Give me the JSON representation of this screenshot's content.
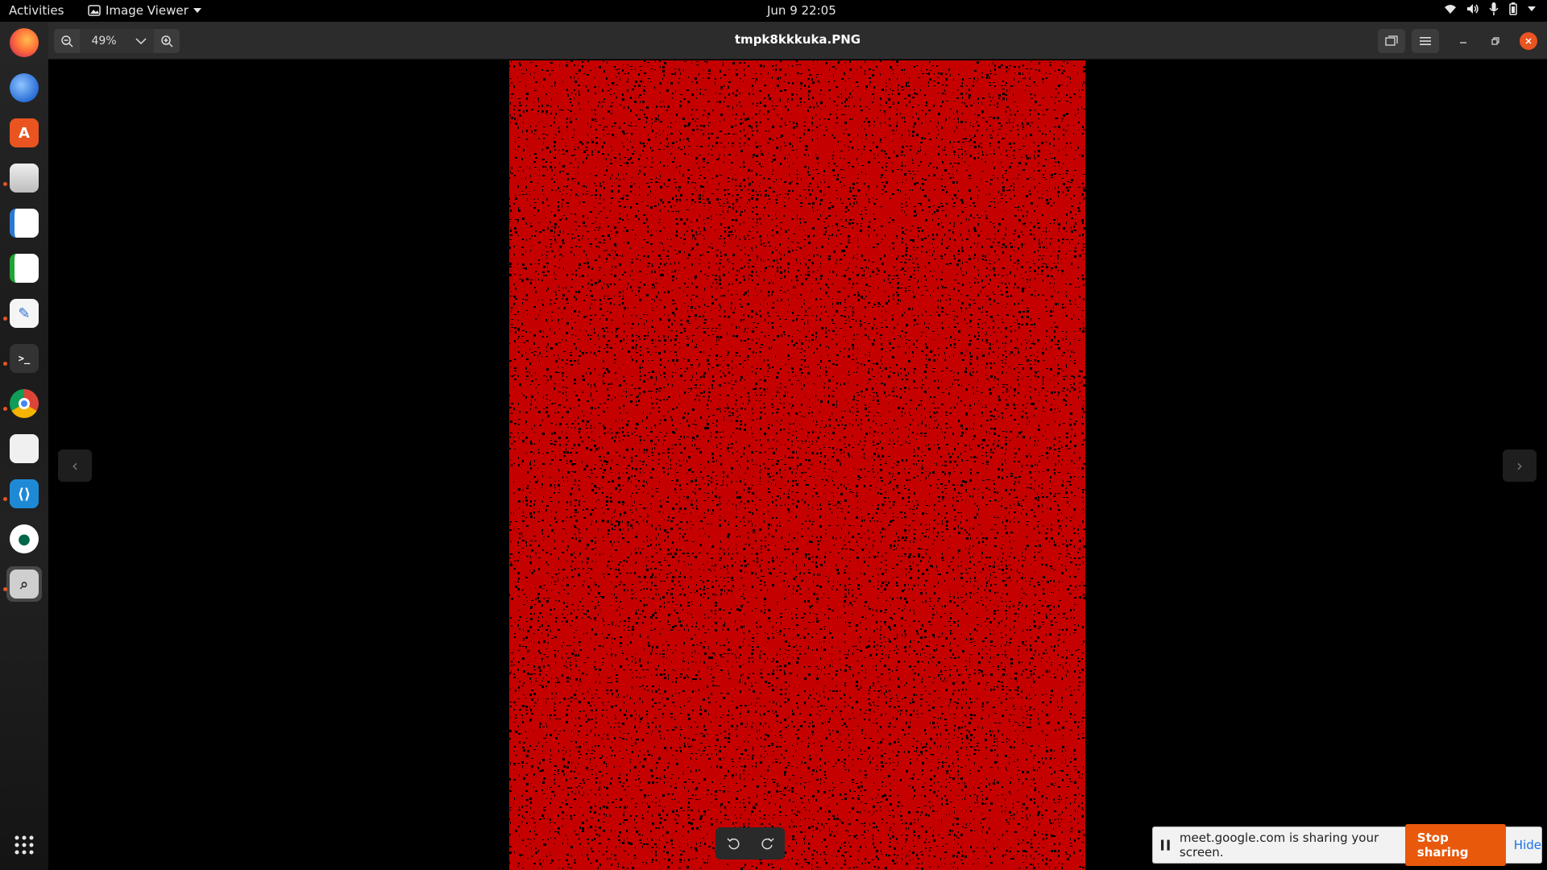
{
  "topbar": {
    "activities": "Activities",
    "app_name": "Image Viewer",
    "clock": "Jun 9  22:05"
  },
  "dock": {
    "items": [
      {
        "name": "firefox",
        "color": "#e66000"
      },
      {
        "name": "thunderbird",
        "color": "#2a6ed6"
      },
      {
        "name": "app-center",
        "color": "#e95420"
      },
      {
        "name": "files",
        "color": "#c8c8c8"
      },
      {
        "name": "libreoffice-writer",
        "color": "#2a7ad2"
      },
      {
        "name": "libreoffice-calc",
        "color": "#21a336"
      },
      {
        "name": "text-editor",
        "color": "#f0f0f0"
      },
      {
        "name": "terminal",
        "color": "#333333"
      },
      {
        "name": "chrome",
        "color": "#4285f4"
      },
      {
        "name": "document-viewer",
        "color": "#dddddd"
      },
      {
        "name": "vscode",
        "color": "#1e8ad6"
      },
      {
        "name": "mongodb-compass",
        "color": "#00684a"
      },
      {
        "name": "image-viewer",
        "color": "#9a9a9a"
      }
    ]
  },
  "viewer": {
    "zoom_value": "49%",
    "title": "tmpk8kkkuka.PNG",
    "image_color": "#c40000"
  },
  "share": {
    "message": "meet.google.com is sharing your screen.",
    "stop_label": "Stop sharing",
    "hide_label": "Hide"
  }
}
